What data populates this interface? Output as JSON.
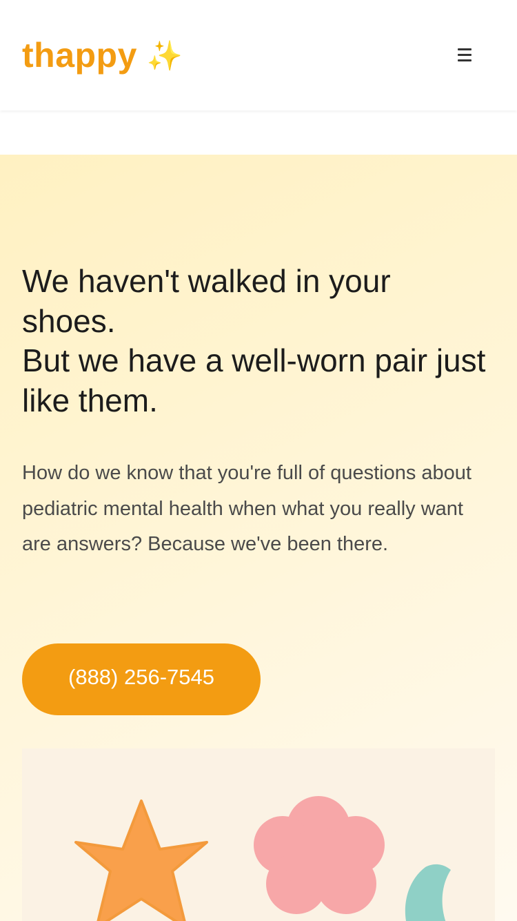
{
  "header": {
    "logo_text": "thappy",
    "logo_sparkle": "✨",
    "menu_icon": "hamburger-menu-icon"
  },
  "hero": {
    "headline_line1": "We haven't walked in your shoes.",
    "headline_line2": "But we have a well-worn pair just like them.",
    "body": "How do we know that you're full of questions about pediatric mental health when what you really want are answers? Because we've been there.",
    "cta_label": "(888) 256-7545"
  },
  "illustration": {
    "shapes": [
      "star-icon",
      "flower-icon",
      "moon-icon"
    ]
  },
  "colors": {
    "brand": "#f39c12",
    "hero_bg": "#fff4d2",
    "headline": "#1c1c1c",
    "body": "#4a4a4a",
    "star": "#f9a04b",
    "flower": "#f7a7a8",
    "moon": "#8fd0c6"
  }
}
